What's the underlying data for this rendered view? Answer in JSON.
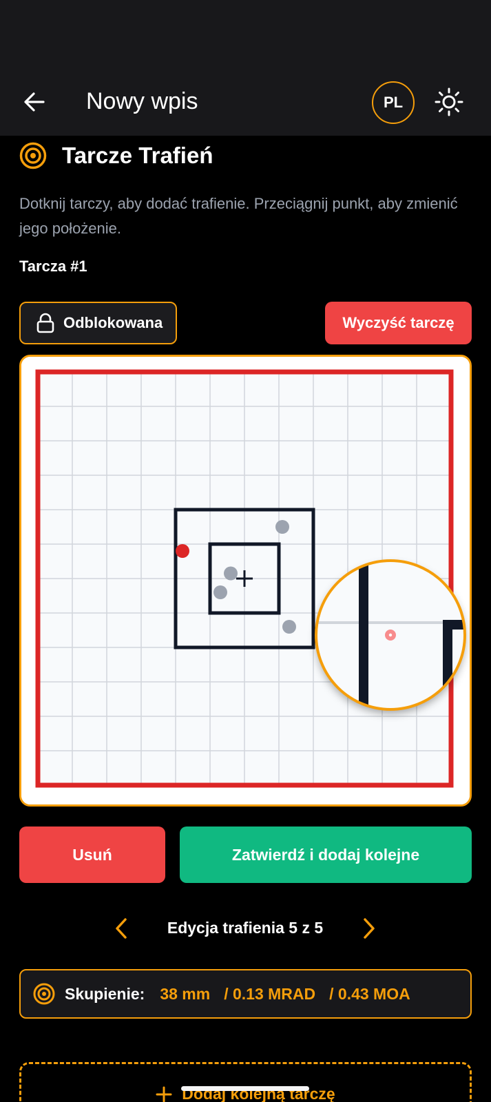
{
  "app_bar": {
    "title": "Nowy wpis",
    "language": "PL"
  },
  "section": {
    "title": "Tarcze Trafień",
    "hint": "Dotknij tarczy, aby dodać trafienie. Przeciągnij punkt, aby zmienić jego położenie.",
    "target_label": "Tarcza #1"
  },
  "controls": {
    "lock_label": "Odblokowana",
    "clear_label": "Wyczyść tarczę"
  },
  "target": {
    "grid_cells": 12,
    "shots": [
      {
        "col": 7.1,
        "row": 4.5,
        "state": "confirmed"
      },
      {
        "col": 5.6,
        "row": 5.85,
        "state": "confirmed"
      },
      {
        "col": 5.3,
        "row": 6.4,
        "state": "confirmed"
      },
      {
        "col": 7.3,
        "row": 7.4,
        "state": "confirmed"
      },
      {
        "col": 4.2,
        "row": 5.2,
        "state": "editing"
      }
    ]
  },
  "actions": {
    "delete_label": "Usuń",
    "confirm_label": "Zatwierdź i dodaj kolejne"
  },
  "pager": {
    "label": "Edycja trafienia 5 z 5"
  },
  "grouping": {
    "label": "Skupienie:",
    "mm": "38 mm",
    "mrad": "/ 0.13 MRAD",
    "moa": "/ 0.43 MOA"
  },
  "add_target": {
    "label": "Dodaj kolejną tarczę"
  },
  "colors": {
    "accent": "#f59e0b",
    "danger": "#ef4444",
    "success": "#10b981",
    "target_frame": "#dc2626",
    "shot_confirmed": "#9ca3af",
    "shot_editing": "#dc2626"
  }
}
